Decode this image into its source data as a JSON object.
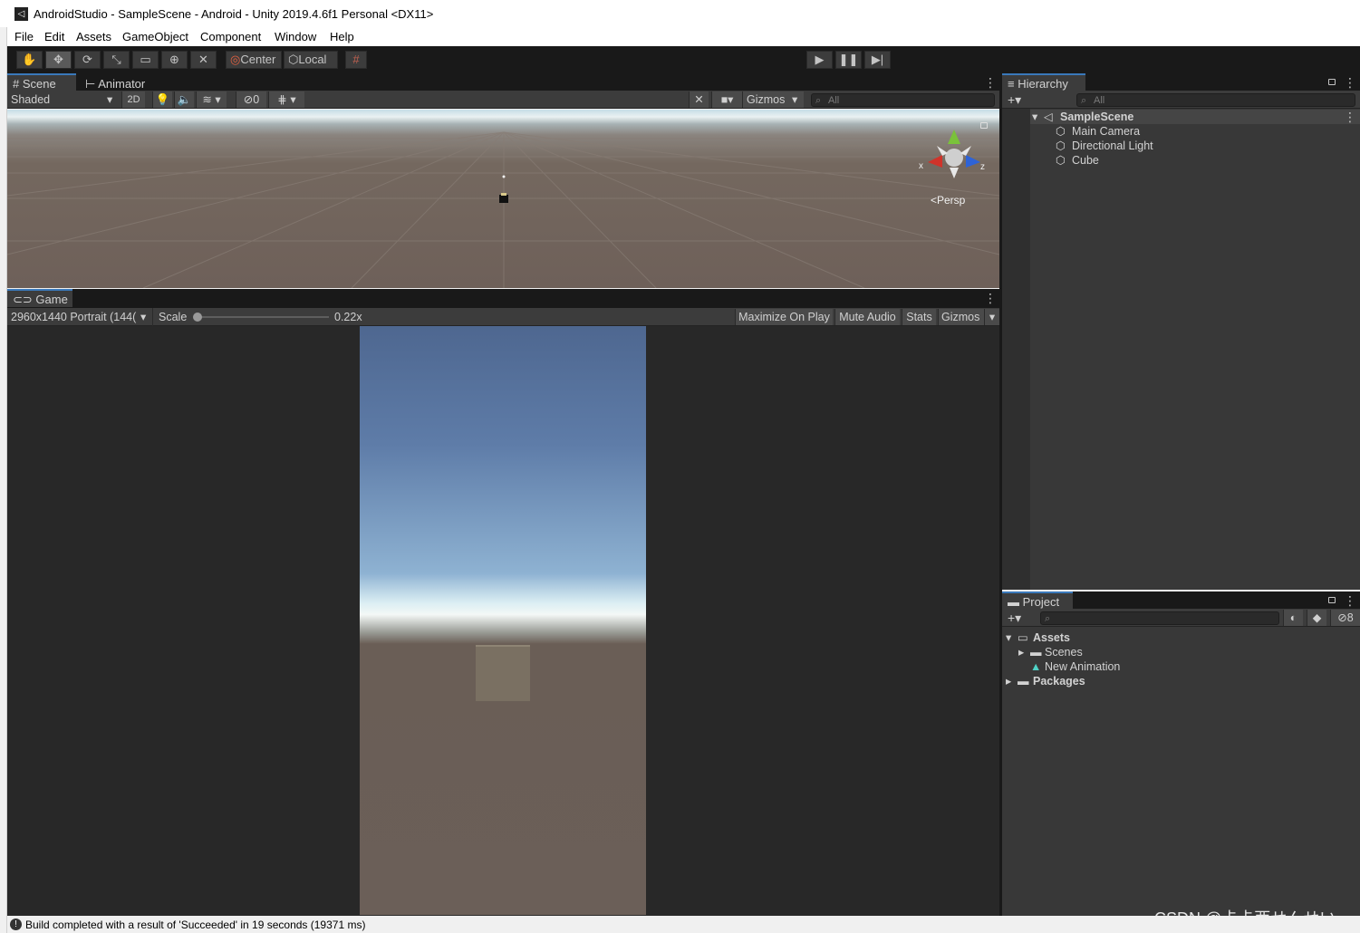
{
  "window": {
    "title": "AndroidStudio - SampleScene - Android - Unity 2019.4.6f1 Personal <DX11>"
  },
  "menu": [
    "File",
    "Edit",
    "Assets",
    "GameObject",
    "Component",
    "Window",
    "Help"
  ],
  "toolbar": {
    "pivot_label": "Center",
    "space_label": "Local"
  },
  "scene_panel": {
    "tabs": [
      "Scene",
      "Animator"
    ],
    "shading_mode": "Shaded",
    "mode_2d": "2D",
    "hidden_count": "0",
    "gizmos_label": "Gizmos",
    "search_placeholder": "All",
    "gizmo_x": "x",
    "gizmo_z": "z",
    "persp_label": "<Persp"
  },
  "game_panel": {
    "tab": "Game",
    "resolution": "2960x1440 Portrait (144(",
    "scale_label": "Scale",
    "scale_value": "0.22x",
    "scale_fraction": 0.0,
    "buttons": [
      "Maximize On Play",
      "Mute Audio",
      "Stats",
      "Gizmos"
    ]
  },
  "hierarchy": {
    "tab": "Hierarchy",
    "search_placeholder": "All",
    "scene": "SampleScene",
    "objects": [
      "Main Camera",
      "Directional Light",
      "Cube"
    ]
  },
  "project": {
    "tab": "Project",
    "hidden_count": "8",
    "assets_label": "Assets",
    "assets_children": [
      "Scenes",
      "New Animation"
    ],
    "packages_label": "Packages"
  },
  "status": {
    "message": "Build completed with a result of 'Succeeded' in 19 seconds (19371 ms)"
  },
  "watermark": "CSDN @卡卡西せんせい",
  "colors": {
    "accent": "#3a79bb",
    "panel": "#3c3c3c",
    "dark": "#191919"
  }
}
